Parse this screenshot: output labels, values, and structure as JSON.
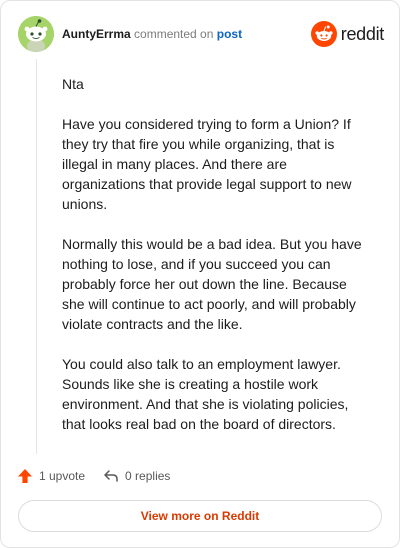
{
  "header": {
    "username": "AuntyErrma",
    "action_text": "commented on",
    "post_link": "post",
    "brand_name": "reddit"
  },
  "comment": {
    "paragraphs": [
      "Nta",
      "Have you considered trying to form a Union? If they try that fire you while organizing, that is illegal in many places. And there are organizations that provide legal support to new unions.",
      "Normally this would be a bad idea. But you have nothing to lose, and if you succeed you can probably force her out down the line. Because she will continue to act poorly, and will probably violate contracts and the like.",
      "You could also talk to an employment lawyer. Sounds like she is creating a hostile work environment. And that she is violating policies, that looks real bad on the board of directors."
    ]
  },
  "actions": {
    "upvote_label": "1 upvote",
    "replies_label": "0 replies"
  },
  "footer": {
    "view_more_label": "View more on Reddit"
  },
  "colors": {
    "accent": "#ff4500",
    "link": "#0a66c2",
    "button_text": "#d93a00",
    "avatar_bg": "#a6d468"
  },
  "icons": {
    "avatar": "snoo-avatar",
    "brand": "reddit-logo-icon",
    "upvote": "upvote-arrow-icon",
    "reply": "reply-arrow-icon"
  }
}
